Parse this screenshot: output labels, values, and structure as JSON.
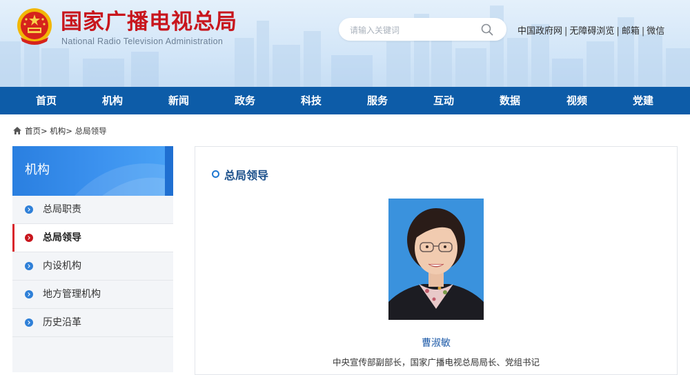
{
  "header": {
    "site_title": "国家广播电视总局",
    "site_subtitle": "National Radio Television Administration",
    "search_placeholder": "请输入关键词",
    "links": [
      {
        "label": "中国政府网"
      },
      {
        "label": "无障碍浏览"
      },
      {
        "label": "邮箱"
      },
      {
        "label": "微信"
      }
    ],
    "separator": "|"
  },
  "nav": {
    "items": [
      {
        "label": "首页"
      },
      {
        "label": "机构"
      },
      {
        "label": "新闻"
      },
      {
        "label": "政务"
      },
      {
        "label": "科技"
      },
      {
        "label": "服务"
      },
      {
        "label": "互动"
      },
      {
        "label": "数据"
      },
      {
        "label": "视频"
      },
      {
        "label": "党建"
      }
    ]
  },
  "breadcrumb": {
    "items": [
      {
        "label": "首页"
      },
      {
        "label": "机构"
      },
      {
        "label": "总局领导"
      }
    ],
    "separator": ">"
  },
  "sidebar": {
    "title": "机构",
    "items": [
      {
        "label": "总局职责",
        "active": false
      },
      {
        "label": "总局领导",
        "active": true
      },
      {
        "label": "内设机构",
        "active": false
      },
      {
        "label": "地方管理机构",
        "active": false
      },
      {
        "label": "历史沿革",
        "active": false
      }
    ]
  },
  "main": {
    "section_title": "总局领导",
    "leader": {
      "name": "曹淑敏",
      "title": "中央宣传部副部长，国家广播电视总局局长、党组书记"
    }
  },
  "colors": {
    "brand_red": "#c8161d",
    "nav_blue": "#0d5ca8",
    "accent_blue": "#2f80d8"
  },
  "icons": {
    "emblem": "national-emblem-icon",
    "search": "search-icon",
    "home": "home-icon",
    "bullet": "circle-chevron-icon",
    "section": "ring-icon"
  }
}
